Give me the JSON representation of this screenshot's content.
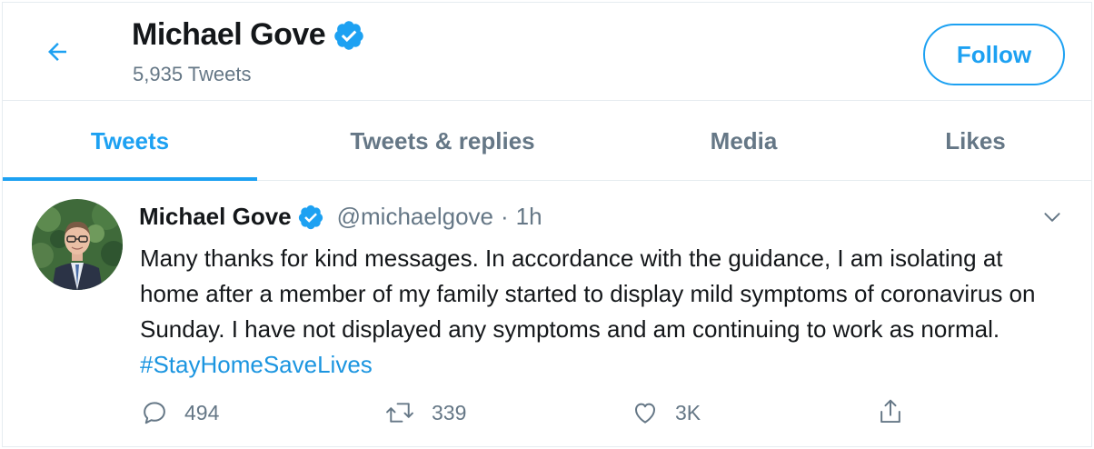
{
  "header": {
    "name": "Michael Gove",
    "tweet_count": "5,935 Tweets",
    "follow_label": "Follow"
  },
  "tabs": [
    {
      "label": "Tweets",
      "active": true
    },
    {
      "label": "Tweets & replies",
      "active": false
    },
    {
      "label": "Media",
      "active": false
    },
    {
      "label": "Likes",
      "active": false
    }
  ],
  "tweet": {
    "author_name": "Michael Gove",
    "handle": "@michaelgove",
    "separator": "·",
    "time": "1h",
    "text": "Many thanks for kind messages. In accordance with the guidance, I am isolating at home after a member of my family started to display mild symptoms of coronavirus on Sunday. I have not displayed any symptoms and am continuing to work as normal.",
    "hashtag": "#StayHomeSaveLives",
    "replies": "494",
    "retweets": "339",
    "likes": "3K"
  },
  "icons": {
    "back": "arrow-left-icon",
    "verified": "verified-badge-icon",
    "caret": "chevron-down-icon",
    "reply": "reply-icon",
    "retweet": "retweet-icon",
    "like": "heart-icon",
    "share": "share-icon"
  },
  "colors": {
    "accent": "#1da1f2",
    "hashtag": "#1b95e0",
    "text": "#14171a",
    "secondary_text": "#657786",
    "border": "#e6ecf0"
  }
}
